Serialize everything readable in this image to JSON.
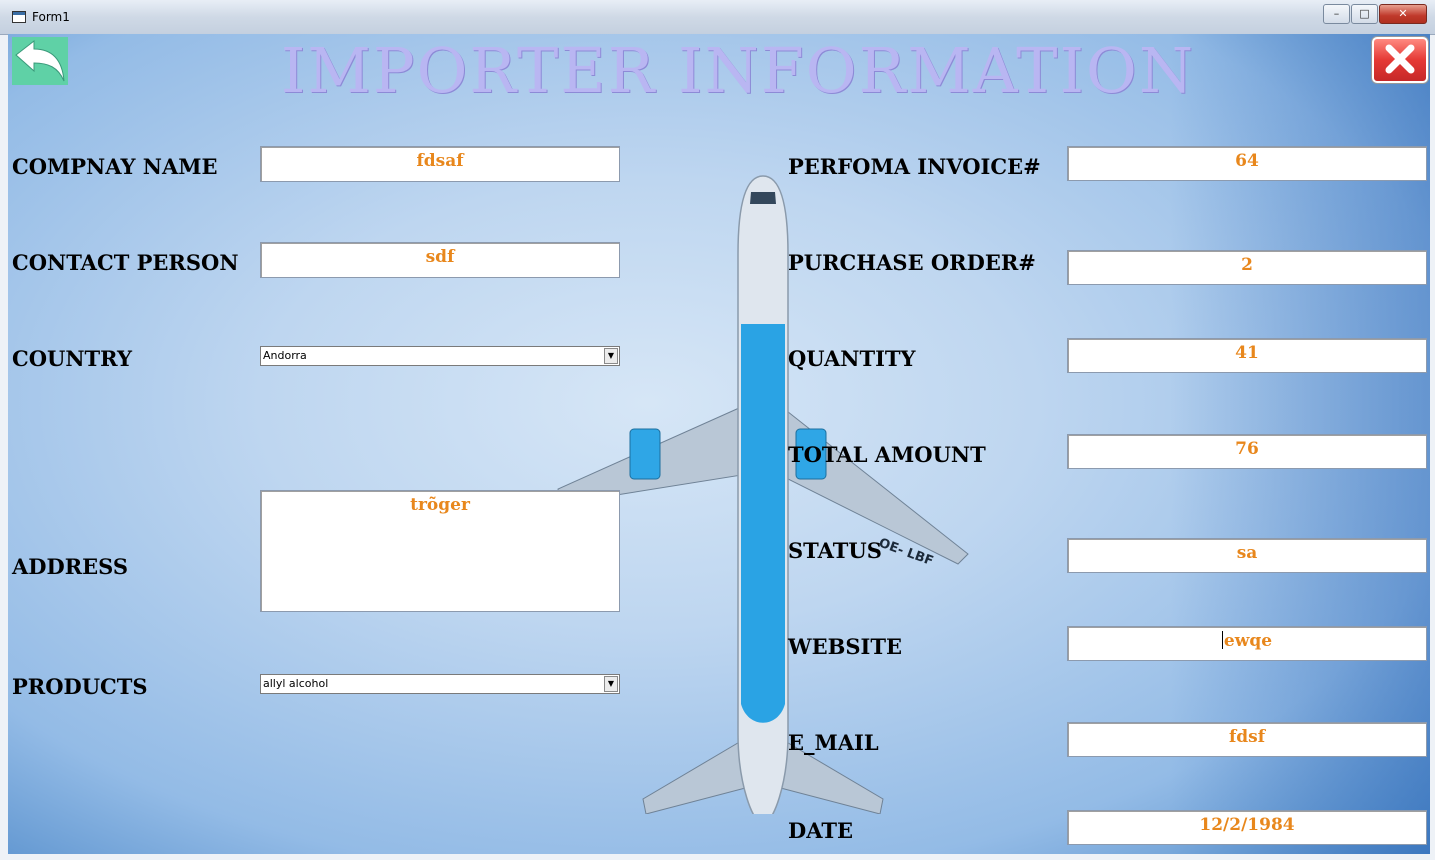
{
  "window": {
    "title": "Form1",
    "minimize_glyph": "–",
    "maximize_glyph": "□",
    "close_glyph": "✕"
  },
  "header": {
    "title": "Importer Information",
    "back_icon": "back-arrow-icon",
    "close_icon": "red-close-icon"
  },
  "left_fields": {
    "company_name": {
      "label": "COMPNAY NAME",
      "value": "fdsaf"
    },
    "contact_person": {
      "label": "CONTACT PERSON",
      "value": "sdf"
    },
    "country": {
      "label": "COUNTRY",
      "value": "Andorra"
    },
    "address": {
      "label": "ADDRESS",
      "value": "trõger"
    },
    "products": {
      "label": "PRODUCTS",
      "value": "allyl alcohol"
    }
  },
  "right_fields": {
    "proforma_invoice": {
      "label": "PERFOMA INVOICE#",
      "value": "64"
    },
    "purchase_order": {
      "label": "PURCHASE ORDER#",
      "value": "2"
    },
    "quantity": {
      "label": "QUANTITY",
      "value": "41"
    },
    "total_amount": {
      "label": "TOTAL AMOUNT",
      "value": "76"
    },
    "status": {
      "label": "STATUS",
      "value": "sa"
    },
    "website": {
      "label": "WEBSITE",
      "value": "ewqe"
    },
    "email": {
      "label": "E_MAIL",
      "value": "fdsf"
    },
    "date": {
      "label": "DATE",
      "value": "12/2/1984"
    }
  },
  "background": {
    "plane_registration": "OE- LBF"
  },
  "colors": {
    "value_text": "#e8871c",
    "title_text": "#b9b6f2",
    "back_button": "#5fd1a6",
    "close_button": "#e53935"
  }
}
